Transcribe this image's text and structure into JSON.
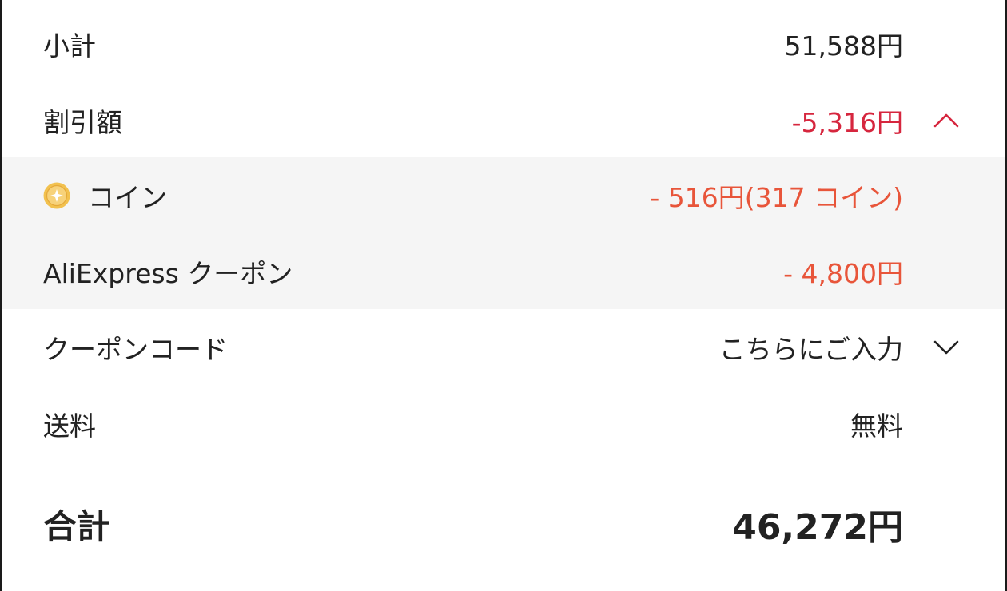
{
  "summary": {
    "subtotal": {
      "label": "小計",
      "value": "51,588円"
    },
    "discount": {
      "label": "割引額",
      "value": "-5,316円",
      "expand_icon": "chevron-up-icon"
    },
    "discount_details": {
      "coin": {
        "label": "コイン",
        "value": "- 516円(317 コイン)",
        "icon": "coin-icon"
      },
      "coupon": {
        "label": "AliExpress クーポン",
        "value": "- 4,800円"
      }
    },
    "coupon_code": {
      "label": "クーポンコード",
      "placeholder": "こちらにご入力",
      "expand_icon": "chevron-down-icon"
    },
    "shipping": {
      "label": "送料",
      "value": "無料"
    },
    "total": {
      "label": "合計",
      "value": "46,272円"
    }
  },
  "colors": {
    "discount_red": "#d6263e",
    "detail_orange": "#e8553a",
    "detail_background": "#f5f5f5",
    "coin_gold": "#f2c14e"
  }
}
